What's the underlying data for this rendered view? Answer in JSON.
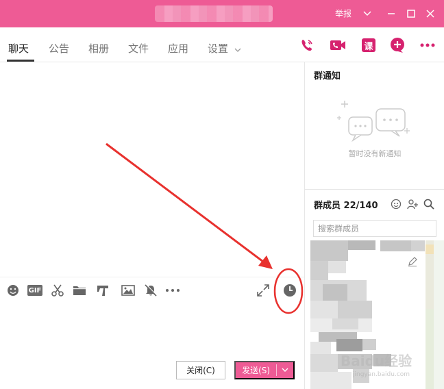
{
  "titlebar": {
    "report_label": "举报"
  },
  "tabs": [
    {
      "label": "聊天",
      "active": true
    },
    {
      "label": "公告"
    },
    {
      "label": "相册"
    },
    {
      "label": "文件"
    },
    {
      "label": "应用"
    },
    {
      "label": "设置"
    }
  ],
  "top_actions": {
    "course_label": "课"
  },
  "notice": {
    "title": "群通知",
    "empty_text": "暂时没有新通知"
  },
  "members": {
    "title": "群成员 22/140",
    "search_placeholder": "搜索群成员"
  },
  "toolbar": {
    "gif_label": "GIF"
  },
  "buttons": {
    "close_label": "关闭(C)",
    "send_label": "发送(S)"
  },
  "watermark": {
    "text": "Baidu经验",
    "sub": "jingyan.baidu.com"
  },
  "colors": {
    "accent": "#ee5b95",
    "brand_dark": "#d6226f",
    "annotation_red": "#e8312e"
  }
}
